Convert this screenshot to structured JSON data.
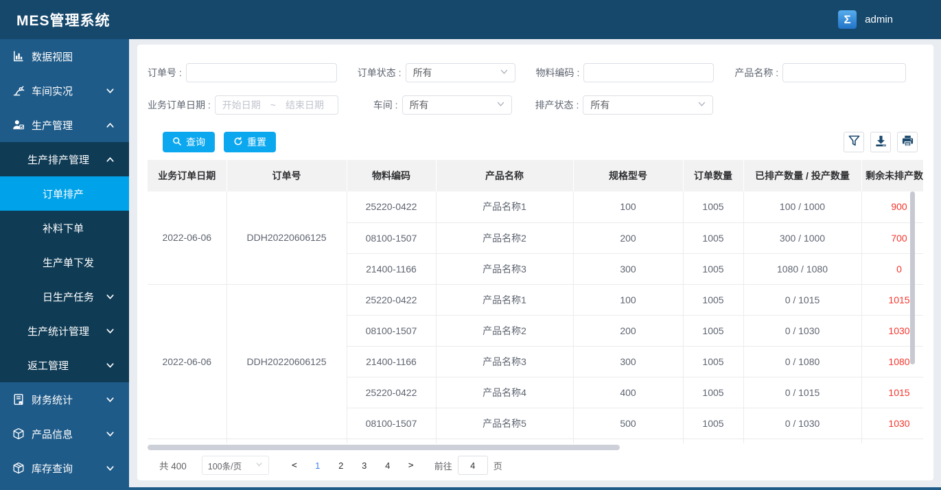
{
  "header": {
    "title": "MES管理系统",
    "badge_glyph": "Σ",
    "user": "admin"
  },
  "colors": {
    "header_bg": "#16486C",
    "sidebar_bg": "#1F5B89",
    "submenu_bg": "#0F3B55",
    "active_menu": "#00A2EA",
    "button_blue": "#0CA8EF",
    "link_blue": "#3C7DF0",
    "danger_red": "#F5352C"
  },
  "sidebar": {
    "items": [
      {
        "id": "data-view",
        "label": "数据视图",
        "icon": "bar-chart-icon",
        "level": 0
      },
      {
        "id": "workshop-live",
        "label": "车间实况",
        "icon": "robot-arm-icon",
        "level": 0,
        "chevron": "down"
      },
      {
        "id": "production-mgmt",
        "label": "生产管理",
        "icon": "person-edit-icon",
        "level": 0,
        "chevron": "up"
      },
      {
        "id": "production-schedule-mgmt",
        "label": "生产排产管理",
        "level": 1,
        "chevron": "up",
        "group": "sub"
      },
      {
        "id": "order-schedule",
        "label": "订单排产",
        "level": 2,
        "active": true,
        "group": "sub"
      },
      {
        "id": "material-supplement",
        "label": "补料下单",
        "level": 2,
        "group": "sub"
      },
      {
        "id": "production-order-issue",
        "label": "生产单下发",
        "level": 2,
        "group": "sub"
      },
      {
        "id": "daily-production-task",
        "label": "日生产任务",
        "level": 2,
        "chevron": "down",
        "group": "sub"
      },
      {
        "id": "production-stats-mgmt",
        "label": "生产统计管理",
        "level": 1,
        "chevron": "down",
        "group": "sub"
      },
      {
        "id": "rework-mgmt",
        "label": "返工管理",
        "level": 1,
        "chevron": "down",
        "group": "sub"
      },
      {
        "id": "finance-stats",
        "label": "财务统计",
        "icon": "document-icon",
        "level": 0,
        "chevron": "down"
      },
      {
        "id": "product-info",
        "label": "产品信息",
        "icon": "cube-icon",
        "level": 0,
        "chevron": "down"
      },
      {
        "id": "inventory-query",
        "label": "库存查询",
        "icon": "package-icon",
        "level": 0,
        "chevron": "down"
      }
    ]
  },
  "filters": {
    "order_no": {
      "label": "订单号 :"
    },
    "order_status": {
      "label": "订单状态 :",
      "value": "所有"
    },
    "material_code": {
      "label": "物料编码 :"
    },
    "product_name": {
      "label": "产品名称 :"
    },
    "order_date": {
      "label": "业务订单日期 :",
      "placeholder": "开始日期　~　结束日期"
    },
    "workshop": {
      "label": "车间 :",
      "value": "所有"
    },
    "schedule_status": {
      "label": "排产状态 :",
      "value": "所有"
    }
  },
  "toolbar": {
    "search_label": "查询",
    "reset_label": "重置",
    "icon_buttons": [
      "filter-icon",
      "download-icon",
      "print-icon"
    ]
  },
  "table": {
    "headers": [
      "业务订单日期",
      "订单号",
      "物料编码",
      "产品名称",
      "规格型号",
      "订单数量",
      "已排产数量 / 投产数量",
      "剩余未排产数量"
    ],
    "groups": [
      {
        "date": "2022-06-06",
        "order_no": "DDH20220606125",
        "rows": [
          {
            "material_code": "25220-0422",
            "product_name": "产品名称1",
            "spec": "100",
            "order_qty": "1005",
            "scheduled_invested": "100 / 1000",
            "remaining": "900"
          },
          {
            "material_code": "08100-1507",
            "product_name": "产品名称2",
            "spec": "200",
            "order_qty": "1005",
            "scheduled_invested": "300 / 1000",
            "remaining": "700"
          },
          {
            "material_code": "21400-1166",
            "product_name": "产品名称3",
            "spec": "300",
            "order_qty": "1005",
            "scheduled_invested": "1080 / 1080",
            "remaining": "0"
          }
        ]
      },
      {
        "date": "2022-06-06",
        "order_no": "DDH20220606125",
        "rows": [
          {
            "material_code": "25220-0422",
            "product_name": "产品名称1",
            "spec": "100",
            "order_qty": "1005",
            "scheduled_invested": "0 / 1015",
            "remaining": "1015"
          },
          {
            "material_code": "08100-1507",
            "product_name": "产品名称2",
            "spec": "200",
            "order_qty": "1005",
            "scheduled_invested": "0 / 1030",
            "remaining": "1030"
          },
          {
            "material_code": "21400-1166",
            "product_name": "产品名称3",
            "spec": "300",
            "order_qty": "1005",
            "scheduled_invested": "0 / 1080",
            "remaining": "1080"
          },
          {
            "material_code": "25220-0422",
            "product_name": "产品名称4",
            "spec": "400",
            "order_qty": "1005",
            "scheduled_invested": "0 / 1015",
            "remaining": "1015"
          },
          {
            "material_code": "08100-1507",
            "product_name": "产品名称5",
            "spec": "500",
            "order_qty": "1005",
            "scheduled_invested": "0 / 1030",
            "remaining": "1030"
          }
        ]
      }
    ]
  },
  "pagination": {
    "total_label": "共 400",
    "page_size": "100条/页",
    "prev": "<",
    "next": ">",
    "pages": [
      "1",
      "2",
      "3",
      "4"
    ],
    "active_page": "1",
    "goto_label": "前往",
    "goto_value": "4",
    "unit_label": "页"
  }
}
